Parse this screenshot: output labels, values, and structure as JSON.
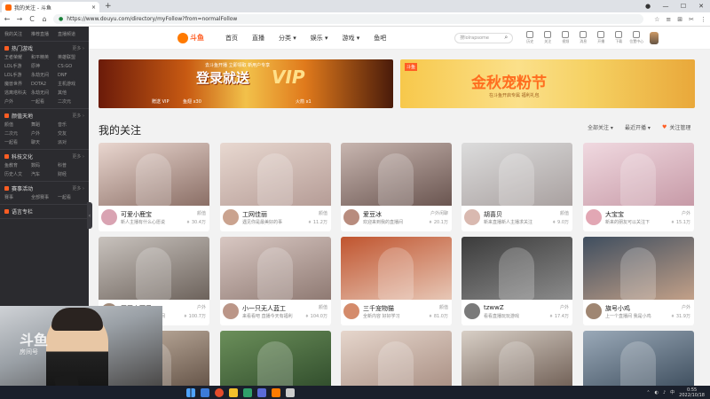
{
  "browser": {
    "tab_title": "我的关注 - 斗鱼",
    "url": "https://www.douyu.com/directory/myFollow?from=normalFollow",
    "back": "←",
    "forward": "→",
    "reload": "C",
    "home": "⌂",
    "secure": "●",
    "new_tab": "+",
    "window_controls": [
      "●",
      "—",
      "☐",
      "✕"
    ],
    "extensions": [
      "☆",
      "≡",
      "⊞",
      "✂",
      "⋮"
    ]
  },
  "site_header": {
    "logo_text": "斗鱼",
    "nav": [
      "首页",
      "直播",
      "分类 ▾",
      "娱乐 ▾",
      "游戏 ▾",
      "鱼吧"
    ],
    "search_placeholder": "搜lolrapsome",
    "search_icon": "⌕",
    "icons": [
      {
        "name": "history-icon",
        "label": "历史"
      },
      {
        "name": "follow-icon",
        "label": "关注"
      },
      {
        "name": "video-icon",
        "label": "视频"
      },
      {
        "name": "message-icon",
        "label": "消息"
      },
      {
        "name": "upgrade-icon",
        "label": "开播"
      },
      {
        "name": "download-icon",
        "label": "下载"
      },
      {
        "name": "location-icon",
        "label": "位置中心"
      }
    ]
  },
  "sidebar": {
    "top_grid": [
      "我的关注",
      "推荐直播",
      "直播频道"
    ],
    "groups": [
      {
        "title": "热门游戏",
        "more": "更多 ›",
        "items": [
          "王者荣耀",
          "和平精英",
          "英雄联盟",
          "LOL手游",
          "原神",
          "CS:GO",
          "LOL手游",
          "永劫无间",
          "DNF",
          "魔兽世界",
          "DOTA2",
          "主机游戏",
          "逃离塔科夫",
          "永劫无间",
          "其他",
          "户外",
          "一起看",
          "二次元"
        ]
      },
      {
        "title": "颜值天地",
        "more": "更多 ›",
        "items": [
          "颜值",
          "舞蹈",
          "音乐",
          "二次元",
          "户外",
          "交友",
          "一起看",
          "聊天",
          "派对"
        ]
      },
      {
        "title": "科技文化",
        "more": "更多 ›",
        "items": [
          "鱼教育",
          "数码",
          "科普",
          "历史人文",
          "汽车",
          "财经"
        ]
      },
      {
        "title": "赛事活动",
        "more": "更多 ›",
        "items": [
          "赛事",
          "全部赛事",
          "一起看"
        ]
      },
      {
        "title": "语言专栏",
        "more": "",
        "items": []
      }
    ]
  },
  "banners": [
    {
      "title": "登录就送",
      "vip": "VIP",
      "sub": "去斗鱼开播 立即领取 新用户专享",
      "badges": [
        "赠送 VIP",
        "鱼翅 x30",
        "火箭 x1"
      ]
    },
    {
      "tag": "斗鱼",
      "title": "金秋宠粉节",
      "sub": "在斗鱼开启专属 福利礼包"
    }
  ],
  "section": {
    "title": "我的关注",
    "sort": "全部关注 ▾",
    "filter": "最近开播 ▾",
    "manage": "关注管理"
  },
  "cards": [
    {
      "title": "可爱小鹿宝",
      "sub": "新人主播有什么心愿说",
      "cat": "颜值",
      "count": "30.4万",
      "colors": [
        "#e9d6cf",
        "#8b6f66"
      ],
      "avatar": "#d9a3b2"
    },
    {
      "title": "工网佳丽",
      "sub": "遇见你是最美好的事",
      "cat": "颜值",
      "count": "11.2万",
      "colors": [
        "#e8d8d0",
        "#b59c96"
      ],
      "avatar": "#caa38f"
    },
    {
      "title": "爱豆冰",
      "sub": "欢迎来到我的直播间",
      "cat": "户外闲聊",
      "count": "20.1万",
      "colors": [
        "#c8b6b0",
        "#6a5550"
      ],
      "avatar": "#b88c7e"
    },
    {
      "title": "胡喜贝",
      "sub": "新来直播新人主播求关注",
      "cat": "颜值",
      "count": "9.0万",
      "colors": [
        "#dcdcdc",
        "#a9a1a0"
      ],
      "avatar": "#d9b9b0"
    },
    {
      "title": "大宝宝",
      "sub": "新来的朋友可以关注下",
      "cat": "户外",
      "count": "15.1万",
      "colors": [
        "#f0d9e0",
        "#c79aa7"
      ],
      "avatar": "#e2a7b4"
    },
    {
      "title": "蛋蛋小可爱",
      "sub": "大家好欢迎来到直播间",
      "cat": "户外",
      "count": "100.7万",
      "colors": [
        "#c8c2bd",
        "#6d635c"
      ],
      "avatar": "#a08a7a"
    },
    {
      "title": "小一只无人蓝工",
      "sub": "来看看吧 直播今天有福利",
      "cat": "颜值",
      "count": "104.0万",
      "colors": [
        "#d8c7c2",
        "#8f7a73"
      ],
      "avatar": "#bb9688"
    },
    {
      "title": "三千宠物猫",
      "sub": "全新内容 好好学习",
      "cat": "颜值",
      "count": "81.0万",
      "colors": [
        "#c0542e",
        "#e7c7b6"
      ],
      "avatar": "#d48b6b"
    },
    {
      "title": "tzwwZ",
      "sub": "看看直播玩玩游戏",
      "cat": "户外",
      "count": "17.4万",
      "colors": [
        "#3b3b3b",
        "#8b8b8b"
      ],
      "avatar": "#7a7a7a"
    },
    {
      "title": "旗号小鸡",
      "sub": "上一个直播间 我是小鸡",
      "cat": "户外",
      "count": "31.9万",
      "colors": [
        "#3f4e5f",
        "#c2a088"
      ],
      "avatar": "#9f8672"
    },
    {
      "title": "",
      "sub": "",
      "cat": "",
      "count": "",
      "colors": [
        "#c9b8a8",
        "#5f4e42"
      ],
      "avatar": ""
    },
    {
      "title": "",
      "sub": "",
      "cat": "",
      "count": "",
      "colors": [
        "#6b8f5a",
        "#2e4a2a"
      ],
      "avatar": ""
    },
    {
      "title": "",
      "sub": "",
      "cat": "",
      "count": "",
      "colors": [
        "#e6d6cc",
        "#a68c80"
      ],
      "avatar": ""
    },
    {
      "title": "",
      "sub": "",
      "cat": "",
      "count": "",
      "colors": [
        "#d8cfc6",
        "#6b5a50"
      ],
      "avatar": ""
    },
    {
      "title": "",
      "sub": "",
      "cat": "",
      "count": "",
      "colors": [
        "#9aa9b8",
        "#3a4a5a"
      ],
      "avatar": ""
    }
  ],
  "webcam": {
    "watermark": "斗鱼",
    "room": "房间号"
  },
  "taskbar": {
    "apps": [
      "#3c7bd9",
      "#e54b2a",
      "#f2c02c",
      "#2f9f6a",
      "#5b6bd8",
      "#ff7a00",
      "#cccccc"
    ],
    "tray": [
      "⌃",
      "◐",
      "♪",
      "中"
    ],
    "time": "0:55",
    "date": "2022/10/18"
  },
  "colors": {
    "brand": "#ff5d23",
    "sidebar_bg": "#2b2b2f"
  }
}
